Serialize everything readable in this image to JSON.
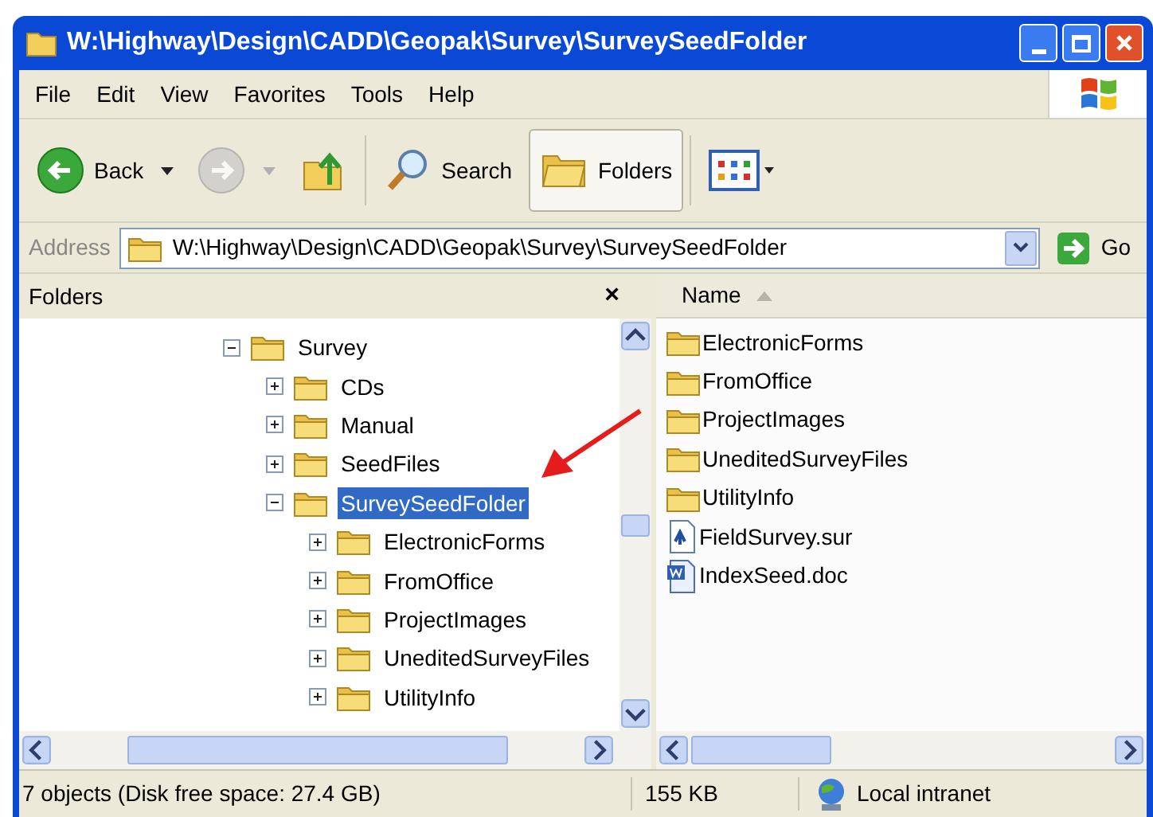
{
  "window": {
    "title": "W:\\Highway\\Design\\CADD\\Geopak\\Survey\\SurveySeedFolder"
  },
  "menu": [
    "File",
    "Edit",
    "View",
    "Favorites",
    "Tools",
    "Help"
  ],
  "toolbar": [
    {
      "kind": "back",
      "label": "Back",
      "disabled": false,
      "selected": false
    },
    {
      "kind": "forward",
      "disabled": true,
      "selected": false
    },
    {
      "kind": "up",
      "disabled": false,
      "selected": false
    },
    {
      "kind": "search",
      "label": "Search",
      "disabled": false,
      "selected": false
    },
    {
      "kind": "folders",
      "label": "Folders",
      "disabled": false,
      "selected": true
    },
    {
      "kind": "views",
      "disabled": false,
      "selected": false
    }
  ],
  "address": {
    "label": "Address",
    "value": "W:\\Highway\\Design\\CADD\\Geopak\\Survey\\SurveySeedFolder",
    "go": "Go"
  },
  "folders_pane": {
    "title": "Folders",
    "close": "×",
    "tree": [
      {
        "name": "Survey",
        "expanded": true,
        "selected": false,
        "children": [
          {
            "name": "CDs",
            "expanded": false,
            "selected": false
          },
          {
            "name": "Manual",
            "expanded": false,
            "selected": false
          },
          {
            "name": "SeedFiles",
            "expanded": false,
            "selected": false
          },
          {
            "name": "SurveySeedFolder",
            "expanded": true,
            "selected": true,
            "children": [
              {
                "name": "ElectronicForms",
                "expanded": false,
                "selected": false
              },
              {
                "name": "FromOffice",
                "expanded": false,
                "selected": false
              },
              {
                "name": "ProjectImages",
                "expanded": false,
                "selected": false
              },
              {
                "name": "UneditedSurveyFiles",
                "expanded": false,
                "selected": false
              },
              {
                "name": "UtilityInfo",
                "expanded": false,
                "selected": false
              }
            ]
          }
        ]
      }
    ]
  },
  "file_list": {
    "column": "Name",
    "files": [
      {
        "name": "ElectronicForms",
        "kind": "folder"
      },
      {
        "name": "FromOffice",
        "kind": "folder"
      },
      {
        "name": "ProjectImages",
        "kind": "folder"
      },
      {
        "name": "UneditedSurveyFiles",
        "kind": "folder"
      },
      {
        "name": "UtilityInfo",
        "kind": "folder"
      },
      {
        "name": "FieldSurvey.sur",
        "kind": "survey"
      },
      {
        "name": "IndexSeed.doc",
        "kind": "document"
      }
    ]
  },
  "status_bar": {
    "objects": "7 objects (Disk free space: 27.4 GB)",
    "size": "155 KB",
    "zone": "Local intranet"
  }
}
